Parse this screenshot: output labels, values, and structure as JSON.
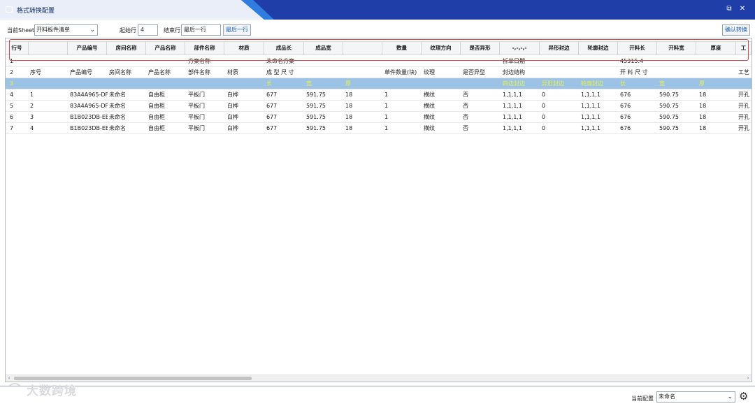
{
  "window": {
    "title": "格式转换配置",
    "restore_icon": "⧉",
    "close_icon": "✕"
  },
  "toolbar": {
    "sheet_label": "当前Sheet",
    "sheet_value": "开料板件清单",
    "start_row_label": "起始行",
    "start_row_value": "4",
    "end_row_label": "结束行",
    "end_row_value": "最后一行",
    "last_row_button": "最后一行",
    "confirm_button": "确认转换"
  },
  "header": [
    "行号",
    "",
    "产品编号",
    "房间名称",
    "产品名称",
    "部件名称",
    "材质",
    "成品长",
    "成品宽",
    "",
    "数量",
    "纹理方向",
    "是否异形",
    "-,-,-,-",
    "异形封边",
    "轮廓封边",
    "开料长",
    "开料宽",
    "厚度",
    "工"
  ],
  "rows": [
    {
      "style": "plain",
      "cells": [
        "1",
        "",
        "",
        "",
        "",
        "方案名称",
        "",
        "未命名方案",
        "",
        "",
        "",
        "",
        "",
        "拆单日期",
        "",
        "",
        "45315.4",
        "",
        "",
        ""
      ]
    },
    {
      "style": "plain",
      "cells": [
        "2",
        "序号",
        "产品编号",
        "房间名称",
        "产品名称",
        "部件名称",
        "材质",
        "成 型 尺 寸",
        "",
        "",
        "单件数量(块)",
        "纹理",
        "是否异型",
        "封边结构",
        "",
        "",
        "开 料 尺 寸",
        "",
        "",
        "工艺"
      ]
    },
    {
      "style": "blue",
      "cells": [
        "3",
        "",
        "",
        "",
        "",
        "",
        "",
        "长",
        "宽",
        "厚",
        "",
        "",
        "",
        "四边封边",
        "异形封边",
        "轮廓封边",
        "长",
        "宽",
        "厚",
        ""
      ]
    },
    {
      "style": "plain",
      "cells": [
        "4",
        "1",
        "83A4A965-DF",
        "未命名",
        "自由柜",
        "平板门",
        "白桦",
        "677",
        "591.75",
        "18",
        "1",
        "横纹",
        "否",
        "1,1,1,1",
        "0",
        "1,1,1,1",
        "676",
        "590.75",
        "18",
        "开孔"
      ]
    },
    {
      "style": "plain",
      "cells": [
        "5",
        "2",
        "83A4A965-DF",
        "未命名",
        "自由柜",
        "平板门",
        "白桦",
        "677",
        "591.75",
        "18",
        "1",
        "横纹",
        "否",
        "1,1,1,1",
        "0",
        "1,1,1,1",
        "676",
        "590.75",
        "18",
        "开孔"
      ]
    },
    {
      "style": "plain",
      "cells": [
        "6",
        "3",
        "B1B023DB-EB",
        "未命名",
        "自由柜",
        "平板门",
        "白桦",
        "677",
        "591.75",
        "18",
        "1",
        "横纹",
        "否",
        "1,1,1,1",
        "0",
        "1,1,1,1",
        "676",
        "590.75",
        "18",
        "开孔"
      ]
    },
    {
      "style": "plain",
      "cells": [
        "7",
        "4",
        "B1B023DB-EB",
        "未命名",
        "自由柜",
        "平板门",
        "白桦",
        "677",
        "591.75",
        "18",
        "1",
        "横纹",
        "否",
        "1,1,1,1",
        "0",
        "1,1,1,1",
        "676",
        "590.75",
        "18",
        "开孔"
      ]
    }
  ],
  "footer": {
    "config_label": "当前配置",
    "config_value": "未命名",
    "watermark": "大数跨境"
  }
}
